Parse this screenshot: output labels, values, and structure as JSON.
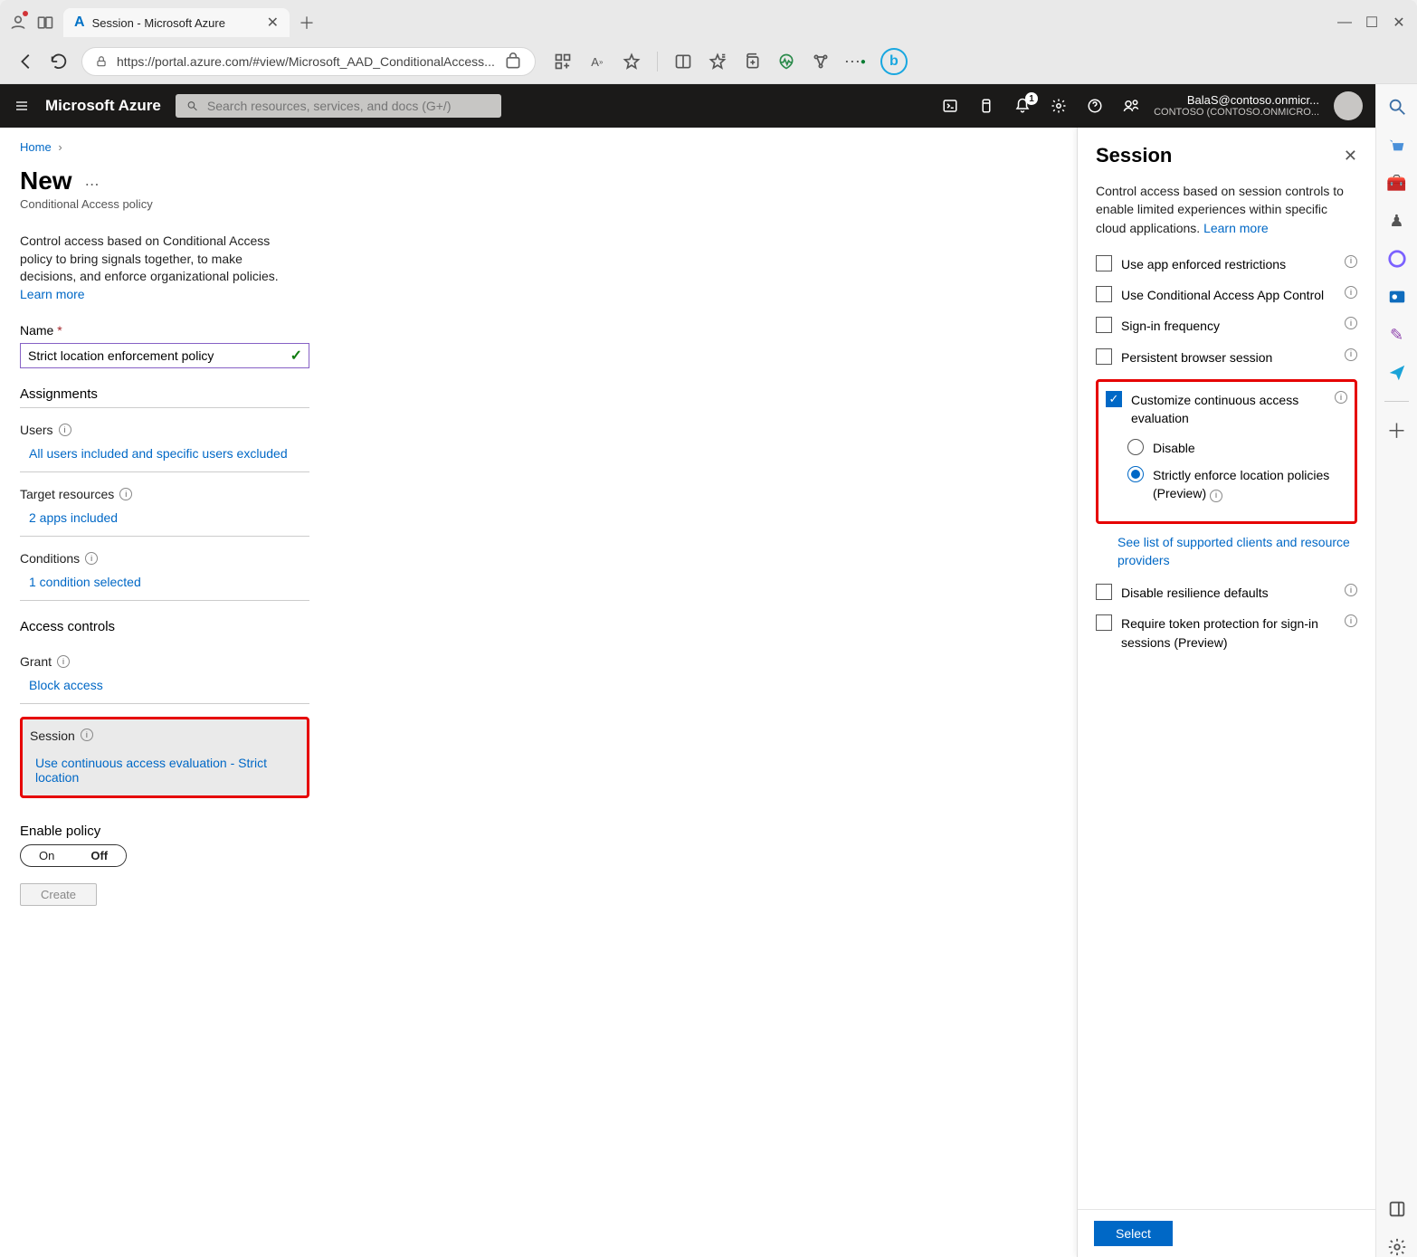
{
  "browser": {
    "tab_title": "Session - Microsoft Azure",
    "url": "https://portal.azure.com/#view/Microsoft_AAD_ConditionalAccess...",
    "notification_dot": true
  },
  "azure_top": {
    "brand": "Microsoft Azure",
    "search_placeholder": "Search resources, services, and docs (G+/)",
    "notification_count": "1",
    "account": {
      "user": "BalaS@contoso.onmicr...",
      "tenant": "CONTOSO (CONTOSO.ONMICRO..."
    }
  },
  "breadcrumb": {
    "home": "Home"
  },
  "page": {
    "title": "New",
    "subtitle": "Conditional Access policy",
    "intro": "Control access based on Conditional Access policy to bring signals together, to make decisions, and enforce organizational policies.",
    "learn_more": "Learn more"
  },
  "form": {
    "name_label": "Name",
    "name_value": "Strict location enforcement policy",
    "assignments_heading": "Assignments",
    "users": {
      "label": "Users",
      "value": "All users included and specific users excluded"
    },
    "targets": {
      "label": "Target resources",
      "value": "2 apps included"
    },
    "conditions": {
      "label": "Conditions",
      "value": "1 condition selected"
    },
    "access_controls_heading": "Access controls",
    "grant": {
      "label": "Grant",
      "value": "Block access"
    },
    "session": {
      "label": "Session",
      "value": "Use continuous access evaluation - Strict location"
    },
    "enable_label": "Enable policy",
    "toggle": {
      "on": "On",
      "off": "Off"
    },
    "create_btn": "Create"
  },
  "panel": {
    "title": "Session",
    "description": "Control access based on session controls to enable limited experiences within specific cloud applications.",
    "learn_more": "Learn more",
    "options": {
      "app_enforced": "Use app enforced restrictions",
      "ca_app_control": "Use Conditional Access App Control",
      "signin_freq": "Sign-in frequency",
      "persistent_browser": "Persistent browser session",
      "customize_cae": "Customize continuous access evaluation",
      "cae_disable": "Disable",
      "cae_strict": "Strictly enforce location policies (Preview)",
      "supported_link": "See list of supported clients and resource providers",
      "disable_resilience": "Disable resilience defaults",
      "token_protection": "Require token protection for sign-in sessions (Preview)"
    },
    "select_btn": "Select"
  }
}
